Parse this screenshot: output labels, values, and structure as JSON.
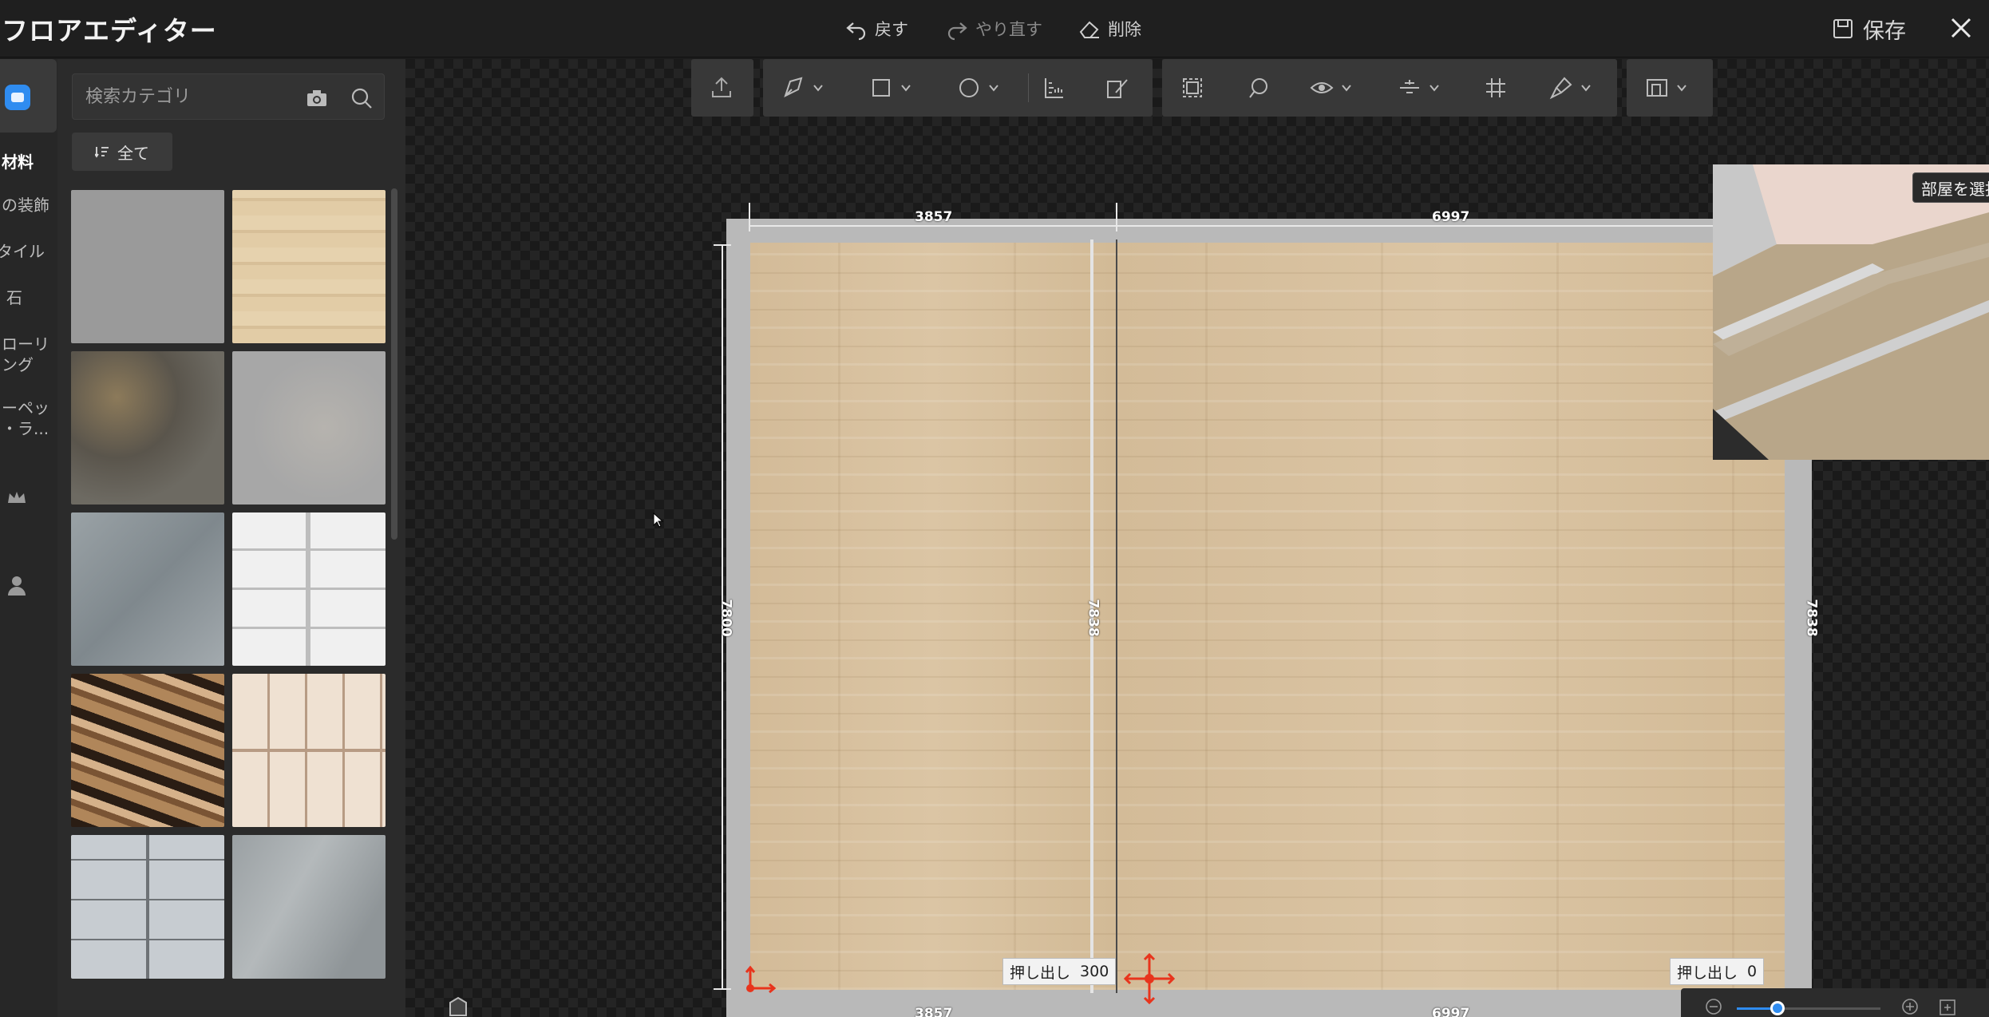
{
  "app": {
    "title": "フロアエディター"
  },
  "topbar": {
    "undo_label": "戻す",
    "redo_label": "やり直す",
    "delete_label": "削除",
    "save_label": "保存"
  },
  "sidebar": {
    "categories": [
      {
        "label": "材料",
        "active": true
      },
      {
        "label": "の装飾"
      },
      {
        "label": "タイル"
      },
      {
        "label": "石"
      },
      {
        "label": "ローリ\nング"
      },
      {
        "label": "ーペッ\n・ラ..."
      }
    ],
    "search_placeholder": "検索カテゴリ",
    "filter_label": "全て",
    "swatches": [
      {
        "name": "gray-plain"
      },
      {
        "name": "light-wood"
      },
      {
        "name": "rust-stone"
      },
      {
        "name": "gray-stone-spotted"
      },
      {
        "name": "gray-granite"
      },
      {
        "name": "white-tile"
      },
      {
        "name": "leopard-pattern"
      },
      {
        "name": "cream-tile"
      },
      {
        "name": "blue-gray-tile"
      },
      {
        "name": "gray-marble"
      }
    ]
  },
  "canvas": {
    "dims": {
      "top_left": "3857",
      "top_right": "6997",
      "left": "7800",
      "mid": "7838",
      "right": "7838",
      "bottom_left": "3857",
      "bottom_right": "6997"
    },
    "extrude_left": {
      "label": "押し出し",
      "value": "300"
    },
    "extrude_right": {
      "label": "押し出し",
      "value": "0"
    }
  },
  "preview": {
    "tooltip": "部屋を選択"
  },
  "colors": {
    "accent": "#2f8cf0",
    "gizmo": "#e8341c",
    "panel": "#2b2b2b",
    "toolbar": "#383838"
  }
}
